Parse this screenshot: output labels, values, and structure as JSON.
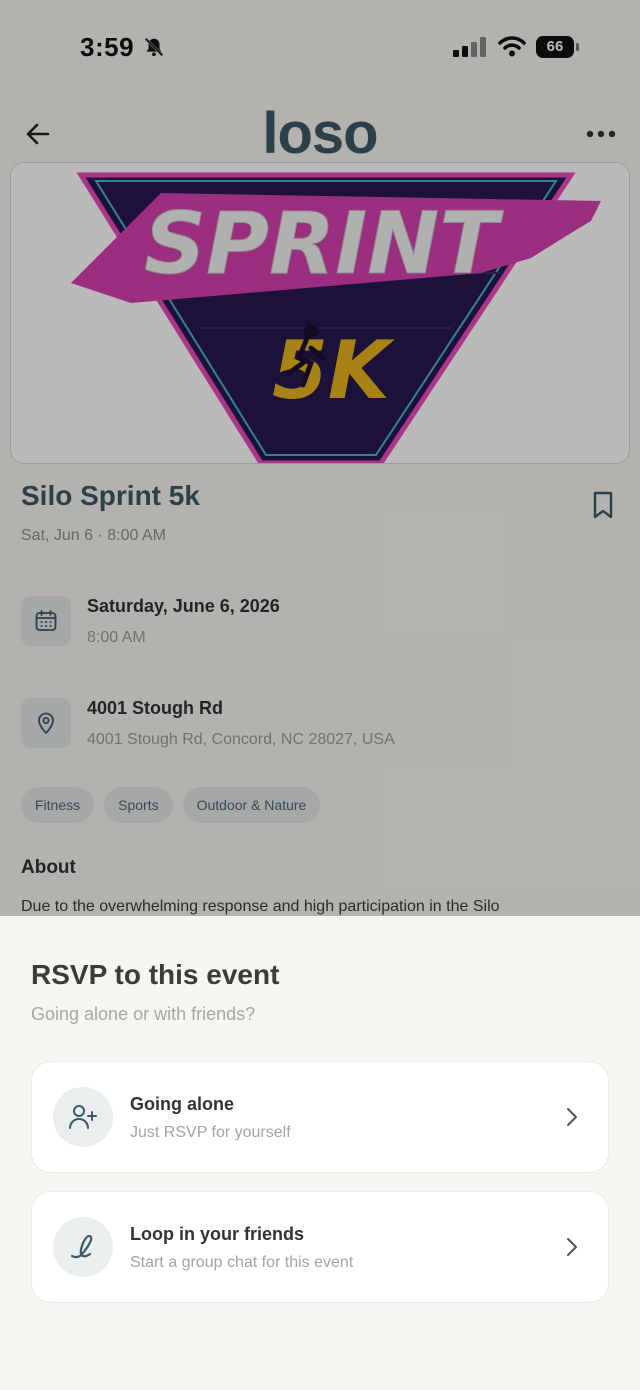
{
  "status_bar": {
    "time": "3:59",
    "battery": "66"
  },
  "nav": {
    "logo": "loso"
  },
  "hero": {
    "line1": "SPRINT",
    "line2": "5K"
  },
  "event": {
    "title": "Silo Sprint 5k",
    "subtitle": "Sat, Jun 6 · 8:00 AM",
    "date_title": "Saturday, June 6, 2026",
    "date_sub": "8:00 AM",
    "location_title": "4001 Stough Rd",
    "location_sub": "4001 Stough Rd, Concord, NC 28027, USA",
    "tags": [
      "Fitness",
      "Sports",
      "Outdoor & Nature"
    ],
    "about_heading": "About",
    "about_text": "Due to the overwhelming response and high participation in the Silo"
  },
  "sheet": {
    "title": "RSVP to this event",
    "subtitle": "Going alone or with friends?",
    "options": [
      {
        "title": "Going alone",
        "subtitle": "Just RSVP for yourself",
        "icon": "user-plus-icon"
      },
      {
        "title": "Loop in your friends",
        "subtitle": "Start a group chat for this event",
        "icon": "loop-icon"
      }
    ]
  },
  "colors": {
    "brand": "#3e5866",
    "sheet_bg": "#f7f5f0",
    "hero_pink": "#d63fb0",
    "hero_purple": "#2a1a5e"
  }
}
